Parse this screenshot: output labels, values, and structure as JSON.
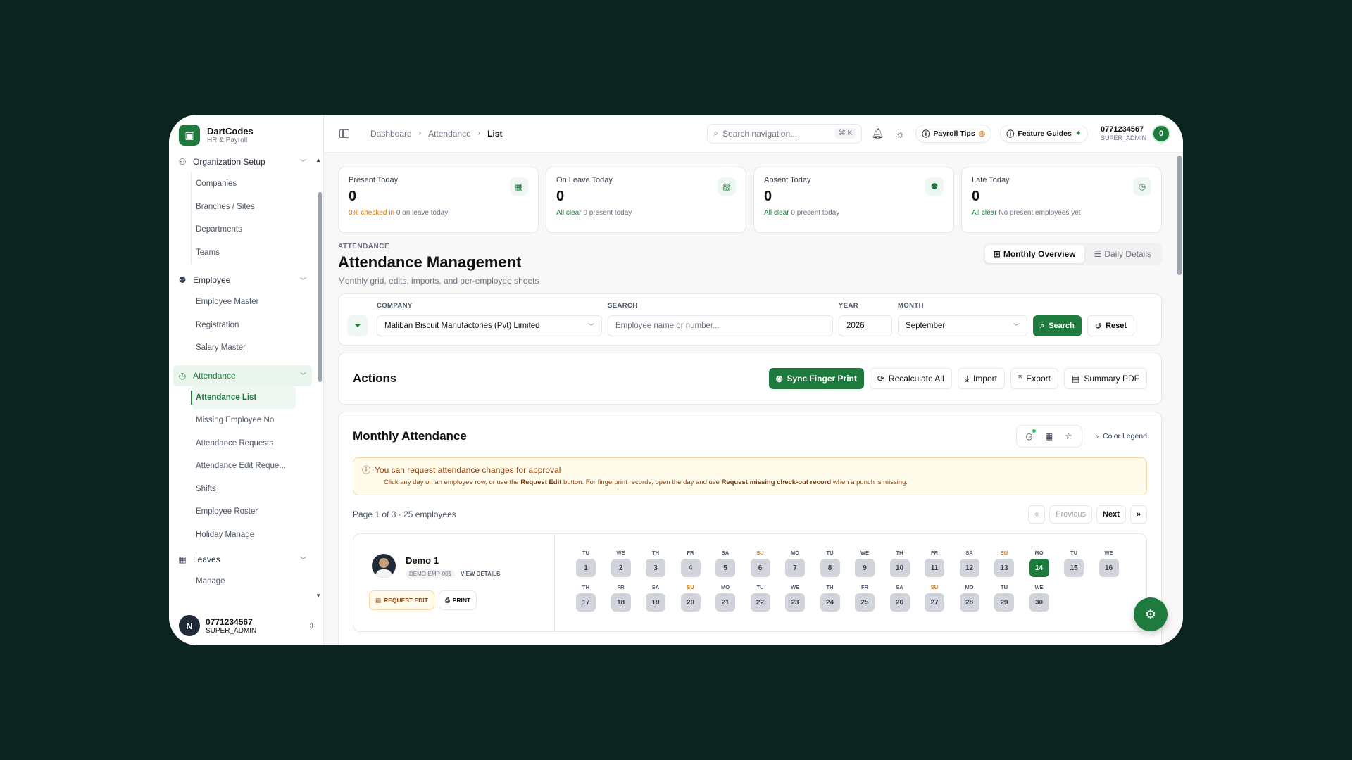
{
  "brand": {
    "name": "DartCodes",
    "sub": "HR & Payroll"
  },
  "sidebar": {
    "groups": [
      {
        "label": "Organization Setup",
        "icon": "org-icon",
        "items": [
          "Companies",
          "Branches / Sites",
          "Departments",
          "Teams"
        ]
      },
      {
        "label": "Employee",
        "icon": "users-icon",
        "items": [
          "Employee Master",
          "Registration",
          "Salary Master"
        ]
      },
      {
        "label": "Attendance",
        "icon": "clock-icon",
        "items": [
          "Attendance List",
          "Missing Employee No",
          "Attendance Requests",
          "Attendance Edit Reque...",
          "Shifts",
          "Employee Roster",
          "Holiday Manage"
        ]
      },
      {
        "label": "Leaves",
        "icon": "calendar-icon",
        "items": [
          "Manage"
        ]
      }
    ],
    "user": {
      "initial": "N",
      "phone": "0771234567",
      "role": "SUPER_ADMIN"
    }
  },
  "topbar": {
    "breadcrumb": [
      "Dashboard",
      "Attendance",
      "List"
    ],
    "search_placeholder": "Search navigation...",
    "shortcut": "⌘ K",
    "payroll_tips": "Payroll Tips",
    "feature_guides": "Feature Guides",
    "user": {
      "phone": "0771234567",
      "role": "SUPER_ADMIN",
      "badge": "0"
    }
  },
  "stats": [
    {
      "title": "Present Today",
      "value": "0",
      "note_a": "0% checked in",
      "note_b": " 0 on leave today",
      "icon": "calendar-check-icon",
      "tone": "o"
    },
    {
      "title": "On Leave Today",
      "value": "0",
      "note_a": "All clear",
      "note_b": " 0 present today",
      "icon": "calendar-off-icon",
      "tone": "g"
    },
    {
      "title": "Absent Today",
      "value": "0",
      "note_a": "All clear",
      "note_b": " 0 present today",
      "icon": "user-x-icon",
      "tone": "g"
    },
    {
      "title": "Late Today",
      "value": "0",
      "note_a": "All clear",
      "note_b": " No present employees yet",
      "icon": "clock-icon",
      "tone": "g"
    }
  ],
  "page": {
    "eyebrow": "ATTENDANCE",
    "title": "Attendance Management",
    "subtitle": "Monthly grid, edits, imports, and per-employee sheets",
    "views": [
      "Monthly Overview",
      "Daily Details"
    ]
  },
  "filter": {
    "company_label": "COMPANY",
    "company_value": "Maliban Biscuit Manufactories (Pvt) Limited",
    "search_label": "SEARCH",
    "search_placeholder": "Employee name or number...",
    "year_label": "YEAR",
    "year_value": "2026",
    "month_label": "MONTH",
    "month_value": "September",
    "search_btn": "Search",
    "reset_btn": "Reset"
  },
  "actions": {
    "title": "Actions",
    "sync": "Sync Finger Print",
    "recalc": "Recalculate All",
    "import": "Import",
    "export": "Export",
    "summary": "Summary PDF"
  },
  "monthly": {
    "title": "Monthly Attendance",
    "legend": "Color Legend",
    "notice_title": "You can request attendance changes for approval",
    "notice_a": "Click any day on an employee row, or use the ",
    "notice_btn": "Request Edit",
    "notice_b": " button. For fingerprint records, open the day and use ",
    "notice_link": "Request missing check-out record",
    "notice_c": " when a punch is missing.",
    "page_info": "Page 1 of 3 · 25 employees",
    "prev": "Previous",
    "next": "Next",
    "first": "«",
    "last": "»",
    "employee": {
      "name": "Demo 1",
      "code": "DEMO-EMP-001",
      "view": "VIEW DETAILS",
      "request_edit": "REQUEST EDIT",
      "print": "PRINT"
    },
    "days_row1": [
      [
        "TU",
        "1"
      ],
      [
        "WE",
        "2"
      ],
      [
        "TH",
        "3"
      ],
      [
        "FR",
        "4"
      ],
      [
        "SA",
        "5"
      ],
      [
        "SU",
        "6"
      ],
      [
        "MO",
        "7"
      ],
      [
        "TU",
        "8"
      ],
      [
        "WE",
        "9"
      ],
      [
        "TH",
        "10"
      ],
      [
        "FR",
        "11"
      ],
      [
        "SA",
        "12"
      ],
      [
        "SU",
        "13"
      ],
      [
        "MO",
        "14"
      ],
      [
        "TU",
        "15"
      ],
      [
        "WE",
        "16"
      ]
    ],
    "days_row2": [
      [
        "TH",
        "17"
      ],
      [
        "FR",
        "18"
      ],
      [
        "SA",
        "19"
      ],
      [
        "SU",
        "20"
      ],
      [
        "MO",
        "21"
      ],
      [
        "TU",
        "22"
      ],
      [
        "WE",
        "23"
      ],
      [
        "TH",
        "24"
      ],
      [
        "FR",
        "25"
      ],
      [
        "SA",
        "26"
      ],
      [
        "SU",
        "27"
      ],
      [
        "MO",
        "28"
      ],
      [
        "TU",
        "29"
      ],
      [
        "WE",
        "30"
      ]
    ],
    "today": "14"
  },
  "colors": {
    "accent": "#1f7a3e",
    "warning": "#d97706"
  }
}
